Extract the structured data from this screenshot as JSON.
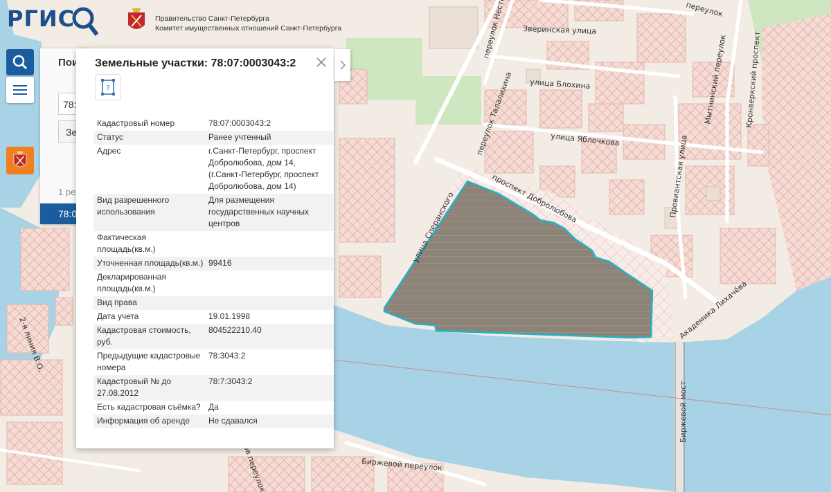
{
  "header": {
    "logo_text": "РГИС",
    "gov_line1": "Правительство Санкт-Петербурга",
    "gov_line2": "Комитет имущественных отношений Санкт-Петербурга"
  },
  "search_panel": {
    "title": "Пои",
    "input1_value": "78:",
    "input2_value": "Зе",
    "result_count": "1 ре",
    "result_item": "78:0"
  },
  "popup": {
    "title": "Земельные участки: 78:07:0003043:2",
    "rows": [
      {
        "key": "Кадастровый номер",
        "value": "78:07:0003043:2"
      },
      {
        "key": "Статус",
        "value": "Ранее учтенный"
      },
      {
        "key": "Адрес",
        "value": "г.Санкт-Петербург, проспект Добролюбова, дом 14, (г.Санкт-Петербург, проспект Добролюбова, дом 14)"
      },
      {
        "key": "Вид разрешенного использования",
        "value": "Для размещения государственных научных центров"
      },
      {
        "key": "Фактическая площадь(кв.м.)",
        "value": ""
      },
      {
        "key": "Уточненная площадь(кв.м.)",
        "value": "99416"
      },
      {
        "key": "Декларированная площадь(кв.м.)",
        "value": ""
      },
      {
        "key": "Вид права",
        "value": ""
      },
      {
        "key": "Дата учета",
        "value": "19.01.1998"
      },
      {
        "key": "Кадастровая стоимость, руб.",
        "value": "804522210.40"
      },
      {
        "key": "Предыдущие кадастровые номера",
        "value": "78:3043:2"
      },
      {
        "key": "Кадастровый № до 27.08.2012",
        "value": "78:7:3043:2"
      },
      {
        "key": "Есть кадастровая съёмка?",
        "value": "Да"
      },
      {
        "key": "Информация об аренде",
        "value": "Не сдавался"
      }
    ]
  },
  "map": {
    "streets": {
      "zverinskaya": "Зверинская улица",
      "blokhina": "улица Блохина",
      "yablochkova": "улица Яблочкова",
      "dobrolyubova": "проспект Добролюбова",
      "talalikhina": "переулок Талалихина",
      "nesterova": "переулок Нестерова",
      "speranskogo": "улица Сперанского",
      "proviantskaya": "Провиантская улица",
      "mytninsky": "Мытнинский переулок",
      "kronverksky": "Кронверкский проспект",
      "likhacheva": "Академика Лихачёва",
      "birzhevoy_most": "Биржевой мост",
      "birzhevoy_per": "Биржевой переулок",
      "liniya": "2-я линия В.О.",
      "pereulok_top": "переулок",
      "pereulok_bottom": "ов переулок"
    },
    "colors": {
      "water": "#a8d2e6",
      "park": "#cfe7c0",
      "land": "#f3ece4",
      "parcel_fill": "#8c8478",
      "parcel_outline": "#21b3c8",
      "hatch": "#d98b8b"
    }
  }
}
